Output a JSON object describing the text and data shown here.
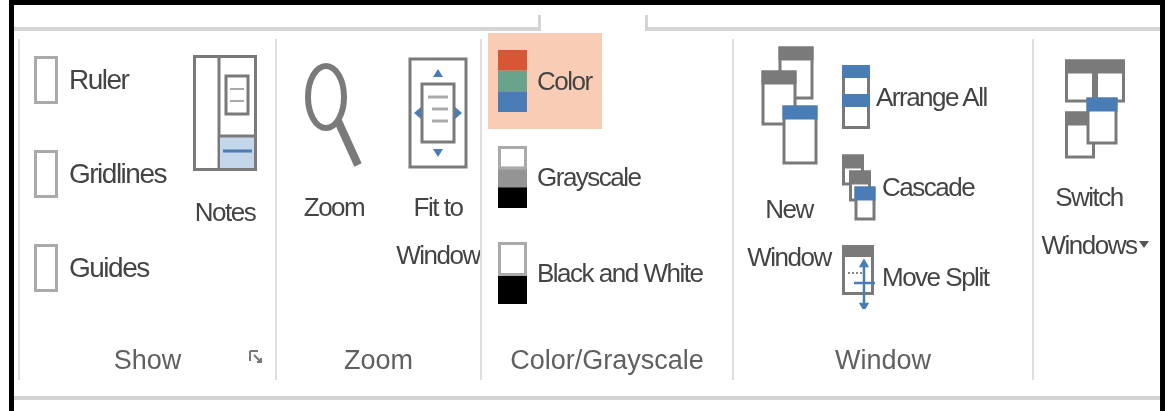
{
  "show": {
    "title": "Show",
    "launcher": true,
    "checkboxes": [
      {
        "label": "Ruler",
        "checked": false
      },
      {
        "label": "Gridlines",
        "checked": false
      },
      {
        "label": "Guides",
        "checked": false
      }
    ],
    "notes": {
      "label": "Notes",
      "selected": false
    }
  },
  "zoom": {
    "title": "Zoom",
    "buttons": [
      {
        "label": "Zoom"
      },
      {
        "label": "Fit to Window"
      }
    ]
  },
  "color": {
    "title": "Color/Grayscale",
    "modes": [
      {
        "label": "Color",
        "selected": true
      },
      {
        "label": "Grayscale",
        "selected": false
      },
      {
        "label": "Black and White",
        "selected": false
      }
    ]
  },
  "window": {
    "title": "Window",
    "new_window": "New Window",
    "small": [
      {
        "label": "Arrange All"
      },
      {
        "label": "Cascade"
      },
      {
        "label": "Move Split"
      }
    ],
    "switch": {
      "label": "Switch Windows",
      "dropdown": true
    }
  }
}
